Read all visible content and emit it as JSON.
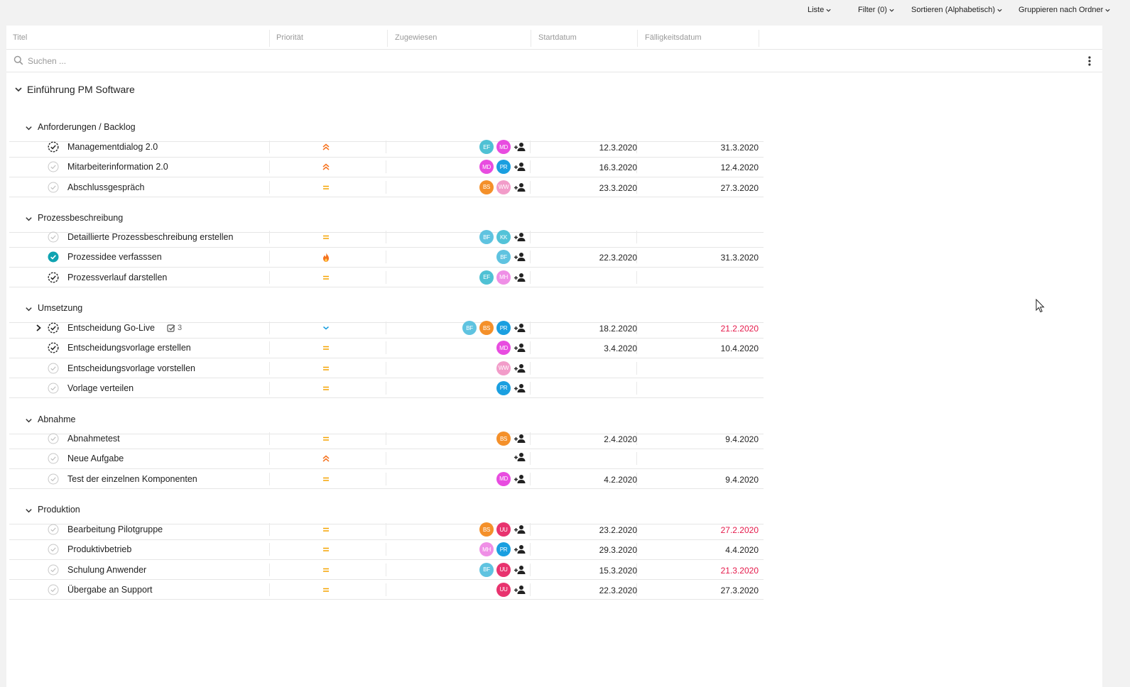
{
  "toolbar": {
    "view": "Liste",
    "filter": "Filter (0)",
    "sort": "Sortieren (Alphabetisch)",
    "group": "Gruppieren nach Ordner"
  },
  "columns": {
    "title": "Titel",
    "priority": "Priorität",
    "assigned": "Zugewiesen",
    "start": "Startdatum",
    "due": "Fälligkeitsdatum"
  },
  "search": {
    "placeholder": "Suchen ..."
  },
  "project": {
    "title": "Einführung PM Software"
  },
  "colors": {
    "overdue": "#e5194a",
    "priority_high": "#f5731f",
    "priority_normal": "#f5a300",
    "priority_low": "#1a9fe0",
    "check_done": "#0fa3b1"
  },
  "avatars": {
    "EF": "#4fc1d4",
    "MD": "#e84ce0",
    "PR": "#1a9fe0",
    "BS": "#f4902a",
    "WW": "#f29cc9",
    "BF": "#5fc3e0",
    "KK": "#53c3d8",
    "MH": "#ef8fe6",
    "UU": "#e8336e"
  },
  "groups": [
    {
      "name": "Anforderungen / Backlog",
      "tasks": [
        {
          "title": "Managementdialog 2.0",
          "status": "in-progress",
          "priority": "high",
          "assignees": [
            "EF",
            "MD"
          ],
          "start": "12.3.2020",
          "due": "31.3.2020",
          "overdue": false
        },
        {
          "title": "Mitarbeiterinformation 2.0",
          "status": "open",
          "priority": "high",
          "assignees": [
            "MD",
            "PR"
          ],
          "start": "16.3.2020",
          "due": "12.4.2020",
          "overdue": false
        },
        {
          "title": "Abschlussgespräch",
          "status": "open",
          "priority": "normal",
          "assignees": [
            "BS",
            "WW"
          ],
          "start": "23.3.2020",
          "due": "27.3.2020",
          "overdue": false
        }
      ]
    },
    {
      "name": "Prozessbeschreibung",
      "tasks": [
        {
          "title": "Detaillierte  Prozessbeschreibung erstellen",
          "status": "open",
          "priority": "normal",
          "assignees": [
            "BF",
            "KK"
          ],
          "start": "",
          "due": "",
          "overdue": false
        },
        {
          "title": "Prozessidee verfasssen",
          "status": "done",
          "priority": "urgent",
          "assignees": [
            "BF"
          ],
          "start": "22.3.2020",
          "due": "31.3.2020",
          "overdue": false
        },
        {
          "title": "Prozessverlauf darstellen",
          "status": "in-progress",
          "priority": "normal",
          "assignees": [
            "EF",
            "MH"
          ],
          "start": "",
          "due": "",
          "overdue": false
        }
      ]
    },
    {
      "name": "Umsetzung",
      "tasks": [
        {
          "title": "Entscheidung Go-Live",
          "status": "in-progress",
          "priority": "low",
          "assignees": [
            "BF",
            "BS",
            "PR"
          ],
          "start": "18.2.2020",
          "due": "21.2.2020",
          "overdue": true,
          "expandable": true,
          "subtasks": "3"
        },
        {
          "title": "Entscheidungsvorlage erstellen",
          "status": "in-progress",
          "priority": "normal",
          "assignees": [
            "MD"
          ],
          "start": "3.4.2020",
          "due": "10.4.2020",
          "overdue": false
        },
        {
          "title": "Entscheidungsvorlage vorstellen",
          "status": "open",
          "priority": "normal",
          "assignees": [
            "WW"
          ],
          "start": "",
          "due": "",
          "overdue": false
        },
        {
          "title": "Vorlage verteilen",
          "status": "open",
          "priority": "normal",
          "assignees": [
            "PR"
          ],
          "start": "",
          "due": "",
          "overdue": false
        }
      ]
    },
    {
      "name": "Abnahme",
      "tasks": [
        {
          "title": "Abnahmetest",
          "status": "open",
          "priority": "normal",
          "assignees": [
            "BS"
          ],
          "start": "2.4.2020",
          "due": "9.4.2020",
          "overdue": false
        },
        {
          "title": "Neue Aufgabe",
          "status": "open",
          "priority": "high",
          "assignees": [],
          "start": "",
          "due": "",
          "overdue": false
        },
        {
          "title": "Test der einzelnen Komponenten",
          "status": "open",
          "priority": "normal",
          "assignees": [
            "MD"
          ],
          "start": "4.2.2020",
          "due": "9.4.2020",
          "overdue": false
        }
      ]
    },
    {
      "name": "Produktion",
      "tasks": [
        {
          "title": "Bearbeitung Pilotgruppe",
          "status": "open",
          "priority": "normal",
          "assignees": [
            "BS",
            "UU"
          ],
          "start": "23.2.2020",
          "due": "27.2.2020",
          "overdue": true
        },
        {
          "title": "Produktivbetrieb",
          "status": "open",
          "priority": "normal",
          "assignees": [
            "MH",
            "PR"
          ],
          "start": "29.3.2020",
          "due": "4.4.2020",
          "overdue": false
        },
        {
          "title": "Schulung Anwender",
          "status": "open",
          "priority": "normal",
          "assignees": [
            "BF",
            "UU"
          ],
          "start": "15.3.2020",
          "due": "21.3.2020",
          "overdue": true
        },
        {
          "title": "Übergabe an Support",
          "status": "open",
          "priority": "normal",
          "assignees": [
            "UU"
          ],
          "start": "22.3.2020",
          "due": "27.3.2020",
          "overdue": false
        }
      ]
    }
  ]
}
